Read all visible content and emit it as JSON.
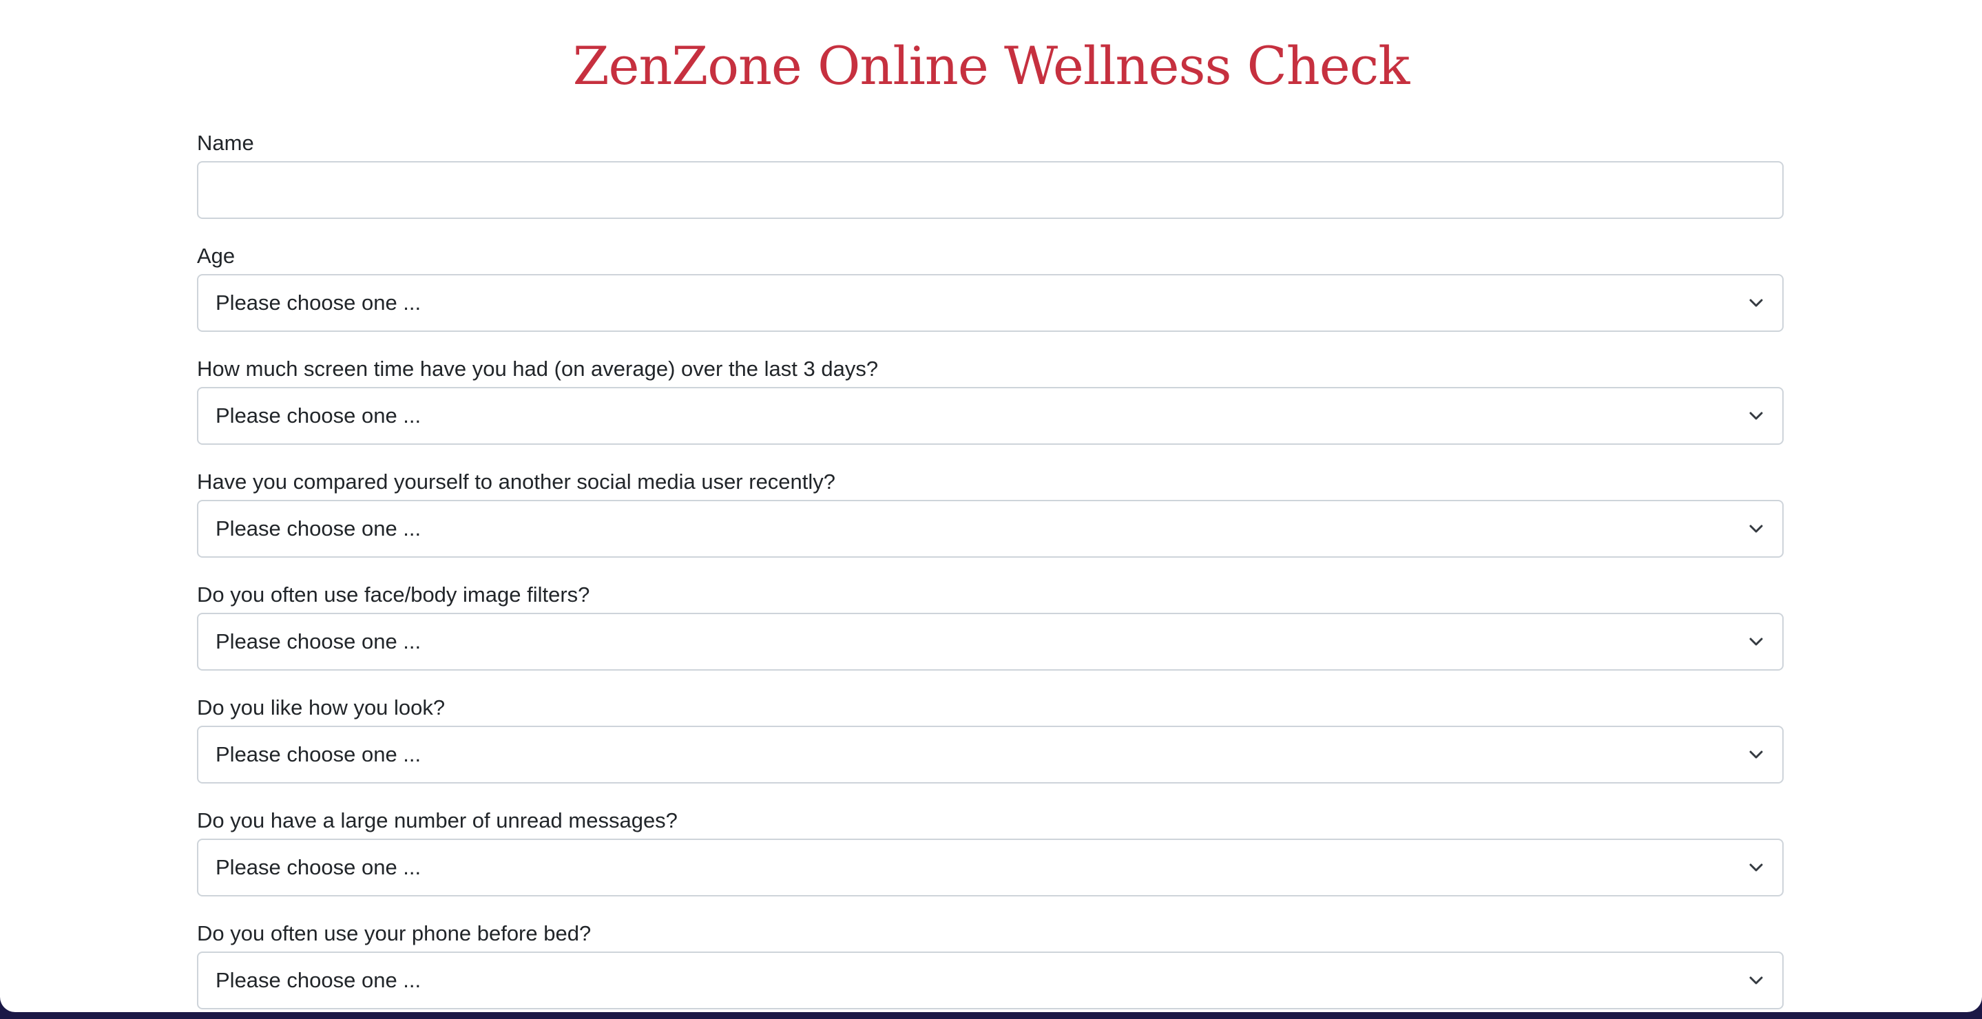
{
  "title": "ZenZone Online Wellness Check",
  "colors": {
    "title": "#c6303f",
    "backdrop": "#1b1846",
    "border": "#ced4da"
  },
  "form": {
    "name": {
      "label": "Name",
      "value": ""
    },
    "selects": [
      {
        "label": "Age",
        "selected": "Please choose one ...",
        "icon": "chevron-down-icon"
      },
      {
        "label": "How much screen time have you had (on average) over the last 3 days?",
        "selected": "Please choose one ...",
        "icon": "chevron-down-icon"
      },
      {
        "label": "Have you compared yourself to another social media user recently?",
        "selected": "Please choose one ...",
        "icon": "chevron-down-icon"
      },
      {
        "label": "Do you often use face/body image filters?",
        "selected": "Please choose one ...",
        "icon": "chevron-down-icon"
      },
      {
        "label": "Do you like how you look?",
        "selected": "Please choose one ...",
        "icon": "chevron-down-icon"
      },
      {
        "label": "Do you have a large number of unread messages?",
        "selected": "Please choose one ...",
        "icon": "chevron-down-icon"
      },
      {
        "label": "Do you often use your phone before bed?",
        "selected": "Please choose one ...",
        "icon": "chevron-down-icon"
      }
    ]
  }
}
